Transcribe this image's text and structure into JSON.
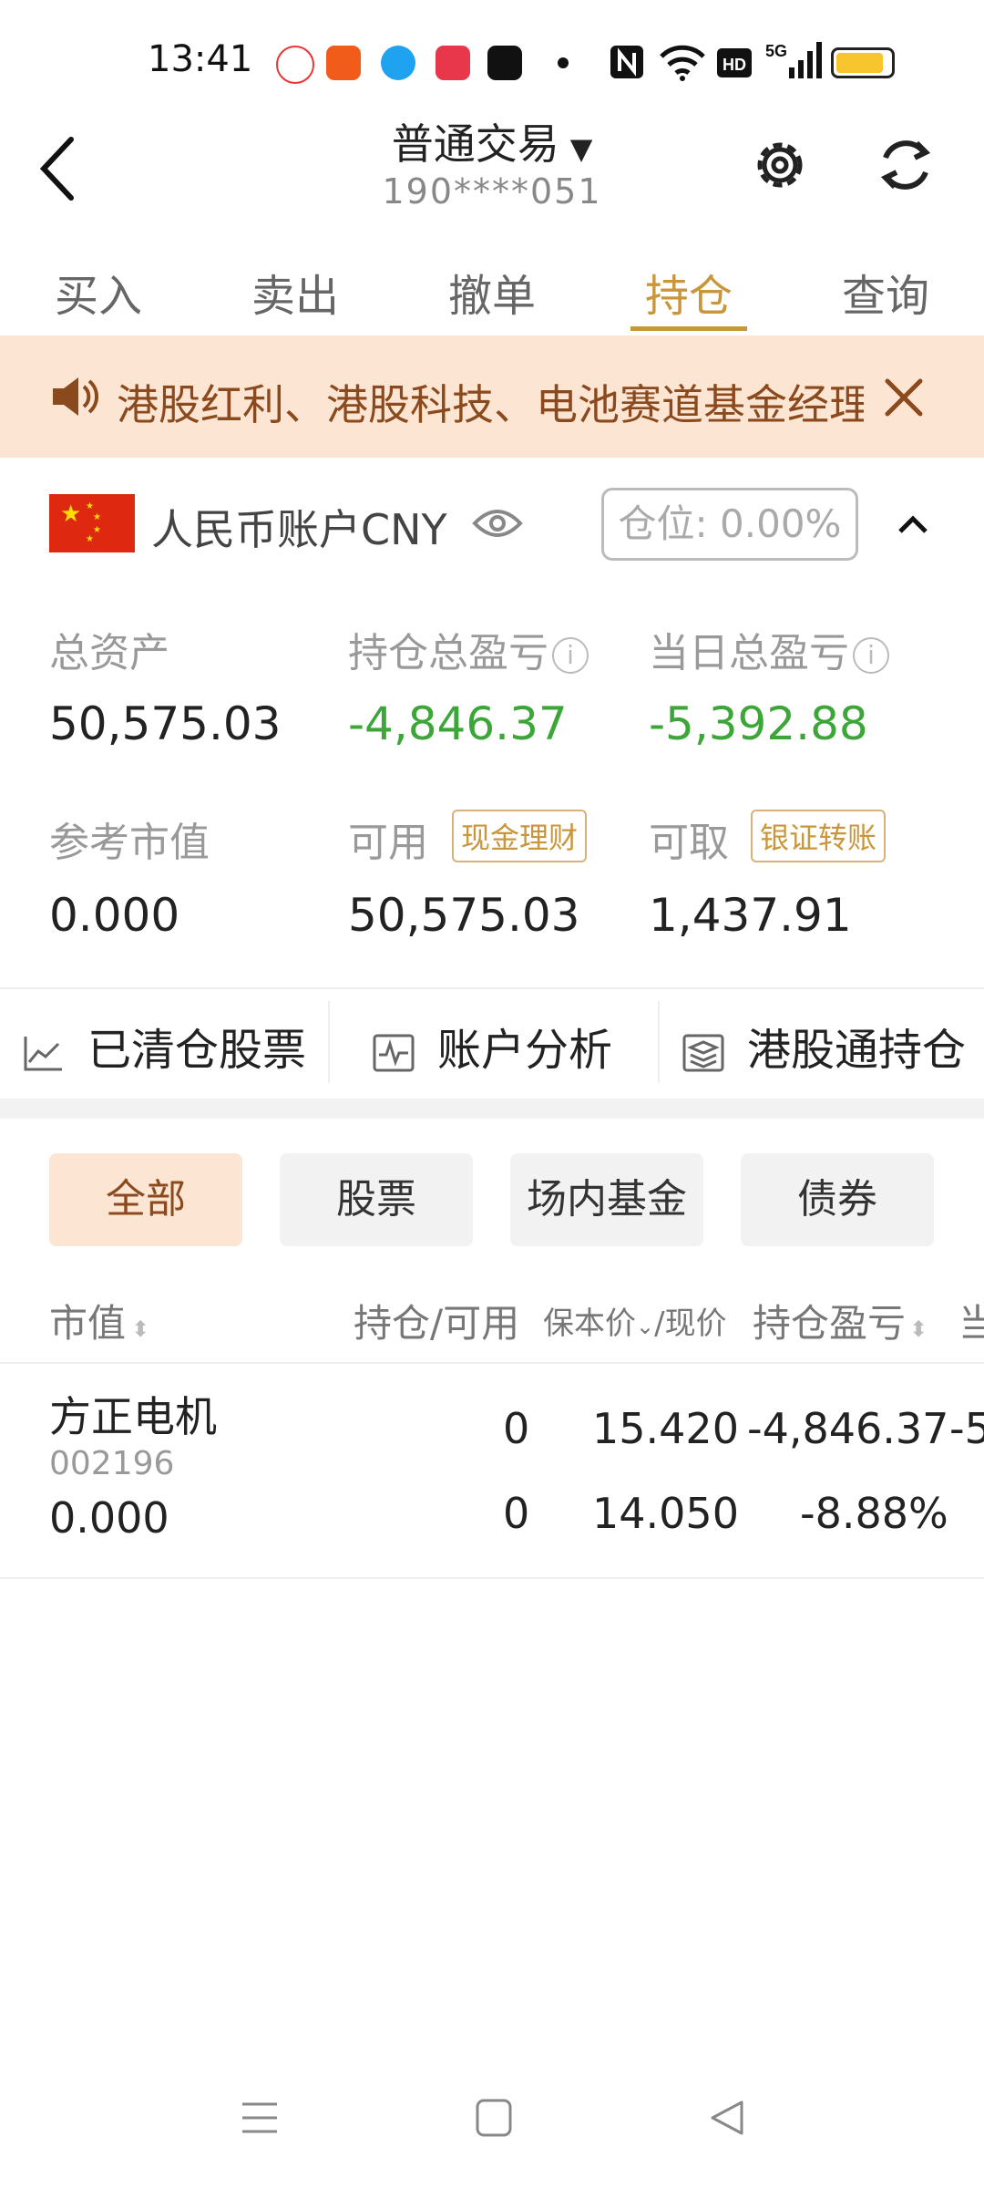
{
  "status_bar": {
    "time": "13:41"
  },
  "header": {
    "title": "普通交易",
    "subtitle": "190****051"
  },
  "tabs": [
    {
      "label": "买入"
    },
    {
      "label": "卖出"
    },
    {
      "label": "撤单"
    },
    {
      "label": "持仓",
      "active": true
    },
    {
      "label": "查询"
    }
  ],
  "banner": {
    "text": "港股红利、港股科技、电池赛道基金经理"
  },
  "account": {
    "name": "人民币账户CNY",
    "position_ratio": "仓位: 0.00%"
  },
  "summary": {
    "total_assets_label": "总资产",
    "total_assets": "50,575.03",
    "position_pl_label": "持仓总盈亏",
    "position_pl": "-4,846.37",
    "daily_pl_label": "当日总盈亏",
    "daily_pl": "-5,392.88",
    "ref_market_value_label": "参考市值",
    "ref_market_value": "0.000",
    "available_label": "可用",
    "available_tag": "现金理财",
    "available": "50,575.03",
    "withdrawable_label": "可取",
    "withdrawable_tag": "银证转账",
    "withdrawable": "1,437.91"
  },
  "quick_actions": [
    {
      "label": "已清仓股票",
      "icon": "chart-line-icon"
    },
    {
      "label": "账户分析",
      "icon": "pulse-icon"
    },
    {
      "label": "港股通持仓",
      "icon": "layers-icon"
    }
  ],
  "filters": [
    {
      "label": "全部",
      "active": true
    },
    {
      "label": "股票"
    },
    {
      "label": "场内基金"
    },
    {
      "label": "债券"
    }
  ],
  "table": {
    "headers": {
      "market_value": "市值",
      "hold_available": "持仓/可用",
      "cost_price": "保本价",
      "current_price": "/现价",
      "position_pl": "持仓盈亏",
      "daily": "当"
    },
    "rows": [
      {
        "name": "方正电机",
        "code": "002196",
        "market_value": "0.000",
        "hold": "0",
        "available": "0",
        "cost": "15.420",
        "current": "14.050",
        "pl": "-4,846.37",
        "pl_pct": "-8.88%",
        "daily_partial": "-5"
      }
    ]
  },
  "colors": {
    "accent": "#c9963b",
    "loss_green": "#3ca639",
    "banner_bg": "#fde5d3"
  }
}
